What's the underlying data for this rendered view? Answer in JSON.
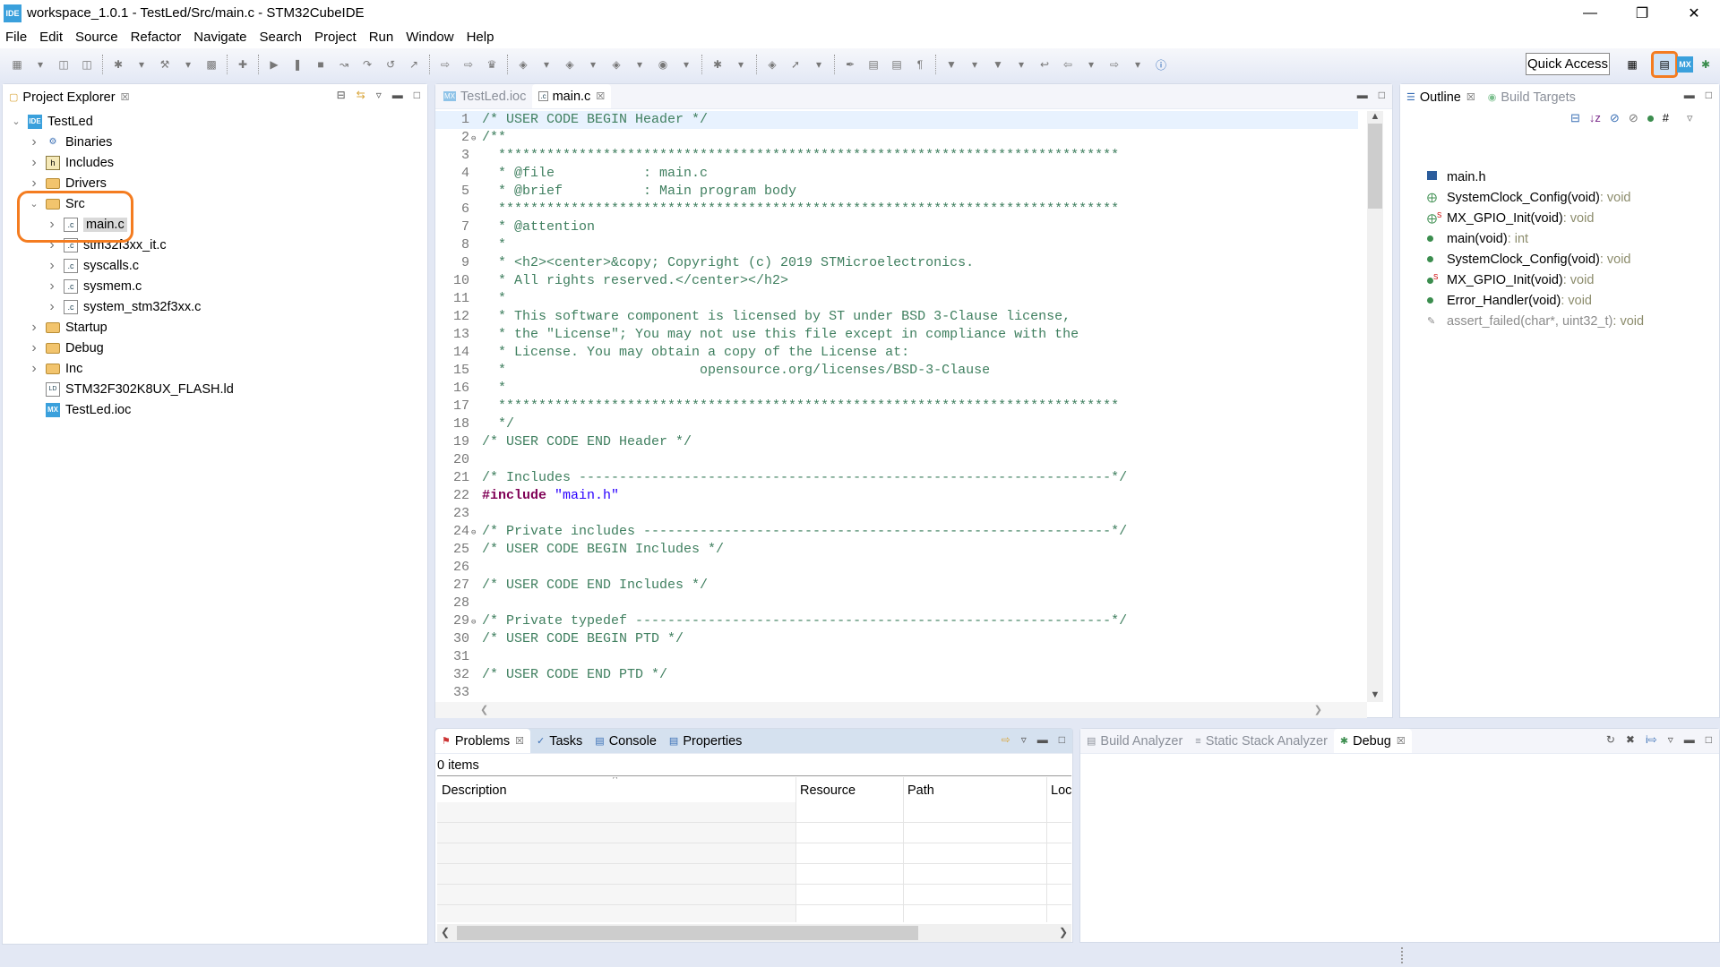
{
  "window": {
    "title": "workspace_1.0.1 - TestLed/Src/main.c - STM32CubeIDE",
    "logo": "IDE",
    "controls": [
      "minimize",
      "restore",
      "close"
    ]
  },
  "menu": [
    "File",
    "Edit",
    "Source",
    "Refactor",
    "Navigate",
    "Search",
    "Project",
    "Run",
    "Window",
    "Help"
  ],
  "toolbar": {
    "quick_access": "Quick Access",
    "perspectives": [
      "open-perspective",
      "cpp-perspective",
      "MX",
      "debug-perspective"
    ],
    "active_perspective": "cpp-perspective"
  },
  "project_explorer": {
    "tab": "Project Explorer",
    "items": [
      {
        "label": "TestLed",
        "depth": 0,
        "twisty": "open",
        "icon": "ide-project"
      },
      {
        "label": "Binaries",
        "depth": 1,
        "twisty": "closed",
        "icon": "binaries"
      },
      {
        "label": "Includes",
        "depth": 1,
        "twisty": "closed",
        "icon": "includes"
      },
      {
        "label": "Drivers",
        "depth": 1,
        "twisty": "closed",
        "icon": "source-folder"
      },
      {
        "label": "Src",
        "depth": 1,
        "twisty": "open",
        "icon": "source-folder"
      },
      {
        "label": "main.c",
        "depth": 2,
        "twisty": "closed",
        "icon": "c-file",
        "selected": true
      },
      {
        "label": "stm32f3xx_it.c",
        "depth": 2,
        "twisty": "closed",
        "icon": "c-file"
      },
      {
        "label": "syscalls.c",
        "depth": 2,
        "twisty": "closed",
        "icon": "c-file"
      },
      {
        "label": "sysmem.c",
        "depth": 2,
        "twisty": "closed",
        "icon": "c-file"
      },
      {
        "label": "system_stm32f3xx.c",
        "depth": 2,
        "twisty": "closed",
        "icon": "c-file"
      },
      {
        "label": "Startup",
        "depth": 1,
        "twisty": "closed",
        "icon": "source-folder"
      },
      {
        "label": "Debug",
        "depth": 1,
        "twisty": "closed",
        "icon": "folder"
      },
      {
        "label": "Inc",
        "depth": 1,
        "twisty": "closed",
        "icon": "folder"
      },
      {
        "label": "STM32F302K8UX_FLASH.ld",
        "depth": 1,
        "twisty": "none",
        "icon": "ld-file"
      },
      {
        "label": "TestLed.ioc",
        "depth": 1,
        "twisty": "none",
        "icon": "mx-file"
      }
    ],
    "highlight_color": "#f47c20"
  },
  "editor": {
    "tabs": [
      {
        "label": "TestLed.ioc",
        "icon": "MX",
        "active": false
      },
      {
        "label": "main.c",
        "icon": ".c",
        "active": true
      }
    ],
    "lines": [
      {
        "n": "1",
        "segs": [
          {
            "t": "/* USER CODE BEGIN Header */",
            "c": "comment"
          }
        ]
      },
      {
        "n": "2",
        "fold": true,
        "segs": [
          {
            "t": "/**",
            "c": "comment"
          }
        ]
      },
      {
        "n": "3",
        "segs": [
          {
            "t": "  *****************************************************************************",
            "c": "comment"
          }
        ]
      },
      {
        "n": "4",
        "segs": [
          {
            "t": "  * @file           : main.c",
            "c": "comment"
          }
        ]
      },
      {
        "n": "5",
        "segs": [
          {
            "t": "  * @brief          : Main program body",
            "c": "comment"
          }
        ]
      },
      {
        "n": "6",
        "segs": [
          {
            "t": "  *****************************************************************************",
            "c": "comment"
          }
        ]
      },
      {
        "n": "7",
        "segs": [
          {
            "t": "  * @attention",
            "c": "comment"
          }
        ]
      },
      {
        "n": "8",
        "segs": [
          {
            "t": "  *",
            "c": "comment"
          }
        ]
      },
      {
        "n": "9",
        "segs": [
          {
            "t": "  * <h2><center>&copy; Copyright (c) 2019 STMicroelectronics.",
            "c": "comment"
          }
        ]
      },
      {
        "n": "10",
        "segs": [
          {
            "t": "  * All rights reserved.</center></h2>",
            "c": "comment"
          }
        ]
      },
      {
        "n": "11",
        "segs": [
          {
            "t": "  *",
            "c": "comment"
          }
        ]
      },
      {
        "n": "12",
        "segs": [
          {
            "t": "  * This software component is licensed by ST under BSD 3-Clause license,",
            "c": "comment"
          }
        ]
      },
      {
        "n": "13",
        "segs": [
          {
            "t": "  * the \"License\"; You may not use this file except in compliance with the",
            "c": "comment"
          }
        ]
      },
      {
        "n": "14",
        "segs": [
          {
            "t": "  * License. You may obtain a copy of the License at:",
            "c": "comment"
          }
        ]
      },
      {
        "n": "15",
        "segs": [
          {
            "t": "  *                        opensource.org/licenses/BSD-3-Clause",
            "c": "comment"
          }
        ]
      },
      {
        "n": "16",
        "segs": [
          {
            "t": "  *",
            "c": "comment"
          }
        ]
      },
      {
        "n": "17",
        "segs": [
          {
            "t": "  *****************************************************************************",
            "c": "comment"
          }
        ]
      },
      {
        "n": "18",
        "segs": [
          {
            "t": "  */",
            "c": "comment"
          }
        ]
      },
      {
        "n": "19",
        "segs": [
          {
            "t": "/* USER CODE END Header */",
            "c": "comment"
          }
        ]
      },
      {
        "n": "20",
        "segs": []
      },
      {
        "n": "21",
        "segs": [
          {
            "t": "/* Includes ------------------------------------------------------------------*/",
            "c": "comment"
          }
        ]
      },
      {
        "n": "22",
        "segs": [
          {
            "t": "#include",
            "c": "keyword"
          },
          {
            "t": " ",
            "c": "plain"
          },
          {
            "t": "\"main.h\"",
            "c": "string"
          }
        ]
      },
      {
        "n": "23",
        "segs": []
      },
      {
        "n": "24",
        "fold": true,
        "segs": [
          {
            "t": "/* Private includes ----------------------------------------------------------*/",
            "c": "comment"
          }
        ]
      },
      {
        "n": "25",
        "segs": [
          {
            "t": "/* USER CODE BEGIN Includes */",
            "c": "comment"
          }
        ]
      },
      {
        "n": "26",
        "segs": []
      },
      {
        "n": "27",
        "segs": [
          {
            "t": "/* USER CODE END Includes */",
            "c": "comment"
          }
        ]
      },
      {
        "n": "28",
        "segs": []
      },
      {
        "n": "29",
        "fold": true,
        "segs": [
          {
            "t": "/* Private typedef -----------------------------------------------------------*/",
            "c": "comment"
          }
        ]
      },
      {
        "n": "30",
        "segs": [
          {
            "t": "/* USER CODE BEGIN PTD */",
            "c": "comment"
          }
        ]
      },
      {
        "n": "31",
        "segs": []
      },
      {
        "n": "32",
        "segs": [
          {
            "t": "/* USER CODE END PTD */",
            "c": "comment"
          }
        ]
      },
      {
        "n": "33",
        "segs": []
      }
    ]
  },
  "outline": {
    "tabs": [
      "Outline",
      "Build Targets"
    ],
    "items": [
      {
        "name": "main.h",
        "type": "",
        "icon": "include"
      },
      {
        "name": "SystemClock_Config(void)",
        "type": " : void",
        "icon": "declaration"
      },
      {
        "name": "MX_GPIO_Init(void)",
        "type": " : void",
        "icon": "declaration-static"
      },
      {
        "name": "main(void)",
        "type": " : int",
        "icon": "function"
      },
      {
        "name": "SystemClock_Config(void)",
        "type": " : void",
        "icon": "function"
      },
      {
        "name": "MX_GPIO_Init(void)",
        "type": " : void",
        "icon": "function-static"
      },
      {
        "name": "Error_Handler(void)",
        "type": " : void",
        "icon": "function"
      },
      {
        "name": "assert_failed(char*, uint32_t)",
        "type": " : void",
        "icon": "inactive-function",
        "inactive": true
      }
    ]
  },
  "problems": {
    "tabs": [
      "Problems",
      "Tasks",
      "Console",
      "Properties"
    ],
    "count": "0 items",
    "columns": [
      "Description",
      "Resource",
      "Path",
      "Loc"
    ]
  },
  "debug_panel": {
    "tabs": [
      "Build Analyzer",
      "Static Stack Analyzer",
      "Debug"
    ]
  }
}
